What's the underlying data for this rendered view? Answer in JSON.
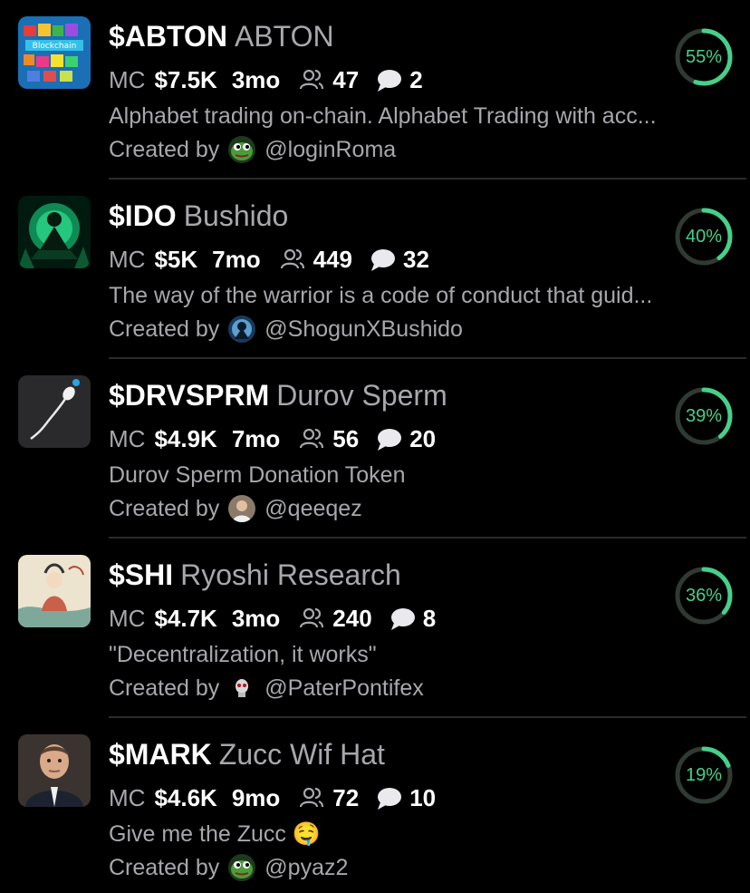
{
  "colors": {
    "background": "#000000",
    "muted_text": "#a7a7ad",
    "progress_accent": "#45d08a",
    "progress_track": "#2f3a33"
  },
  "labels": {
    "market_cap": "MC",
    "created_by": "Created by"
  },
  "tokens": [
    {
      "ticker": "$ABTON",
      "name": "ABTON",
      "market_cap": "$7.5K",
      "age": "3mo",
      "holders": "47",
      "comments": "2",
      "description": "Alphabet trading on-chain. Alphabet Trading with acc...",
      "creator": "@loginRoma",
      "progress_label": "55%",
      "progress_value": 0.55,
      "thumb_icon": "blockchain-letters-icon",
      "avatar_icon": "pepe-frog-avatar"
    },
    {
      "ticker": "$IDO",
      "name": "Bushido",
      "market_cap": "$5K",
      "age": "7mo",
      "holders": "449",
      "comments": "32",
      "description": "The way of the warrior is a code of conduct that guid...",
      "creator": "@ShogunXBushido",
      "progress_label": "40%",
      "progress_value": 0.4,
      "thumb_icon": "samurai-glow-icon",
      "avatar_icon": "samurai-avatar"
    },
    {
      "ticker": "$DRVSPRM",
      "name": "Durov Sperm",
      "market_cap": "$4.9K",
      "age": "7mo",
      "holders": "56",
      "comments": "20",
      "description": "Durov Sperm Donation Token",
      "creator": "@qeeqez",
      "progress_label": "39%",
      "progress_value": 0.39,
      "thumb_icon": "sperm-icon",
      "avatar_icon": "person-avatar"
    },
    {
      "ticker": "$SHI",
      "name": "Ryoshi Research",
      "market_cap": "$4.7K",
      "age": "3mo",
      "holders": "240",
      "comments": "8",
      "description": "\"Decentralization, it works\"",
      "creator": "@PaterPontifex",
      "progress_label": "36%",
      "progress_value": 0.36,
      "thumb_icon": "japanese-painting-icon",
      "avatar_icon": "skull-avatar"
    },
    {
      "ticker": "$MARK",
      "name": "Zucc Wif Hat",
      "market_cap": "$4.6K",
      "age": "9mo",
      "holders": "72",
      "comments": "10",
      "description": "Give me the Zucc 🤤",
      "creator": "@pyaz2",
      "progress_label": "19%",
      "progress_value": 0.19,
      "thumb_icon": "zuckerberg-photo-icon",
      "avatar_icon": "pepe-frog-avatar"
    }
  ]
}
